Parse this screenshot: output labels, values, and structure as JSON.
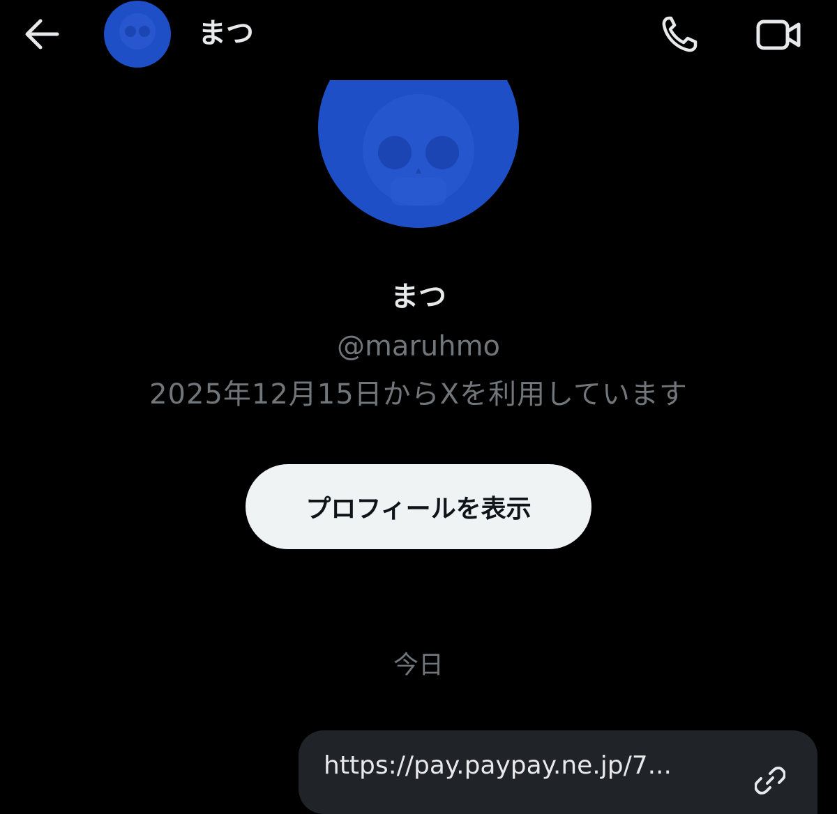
{
  "header": {
    "back_icon": "arrow-left-icon",
    "name": "まつ",
    "call_icon": "phone-icon",
    "video_icon": "video-camera-icon"
  },
  "profile": {
    "name": "まつ",
    "handle": "@maruhmo",
    "joined": "2025年12月15日からXを利用しています",
    "view_profile_label": "プロフィールを表示",
    "avatar_color": "#1e4fc7"
  },
  "conversation": {
    "date_separator": "今日",
    "messages": [
      {
        "text": "https://pay.paypay.ne.jp/7...",
        "icon": "link-icon"
      }
    ]
  },
  "colors": {
    "background": "#000000",
    "primary_text": "#e7e9ea",
    "secondary_text": "#71767b",
    "button_bg": "#eff3f4",
    "bubble_bg": "#202327"
  }
}
